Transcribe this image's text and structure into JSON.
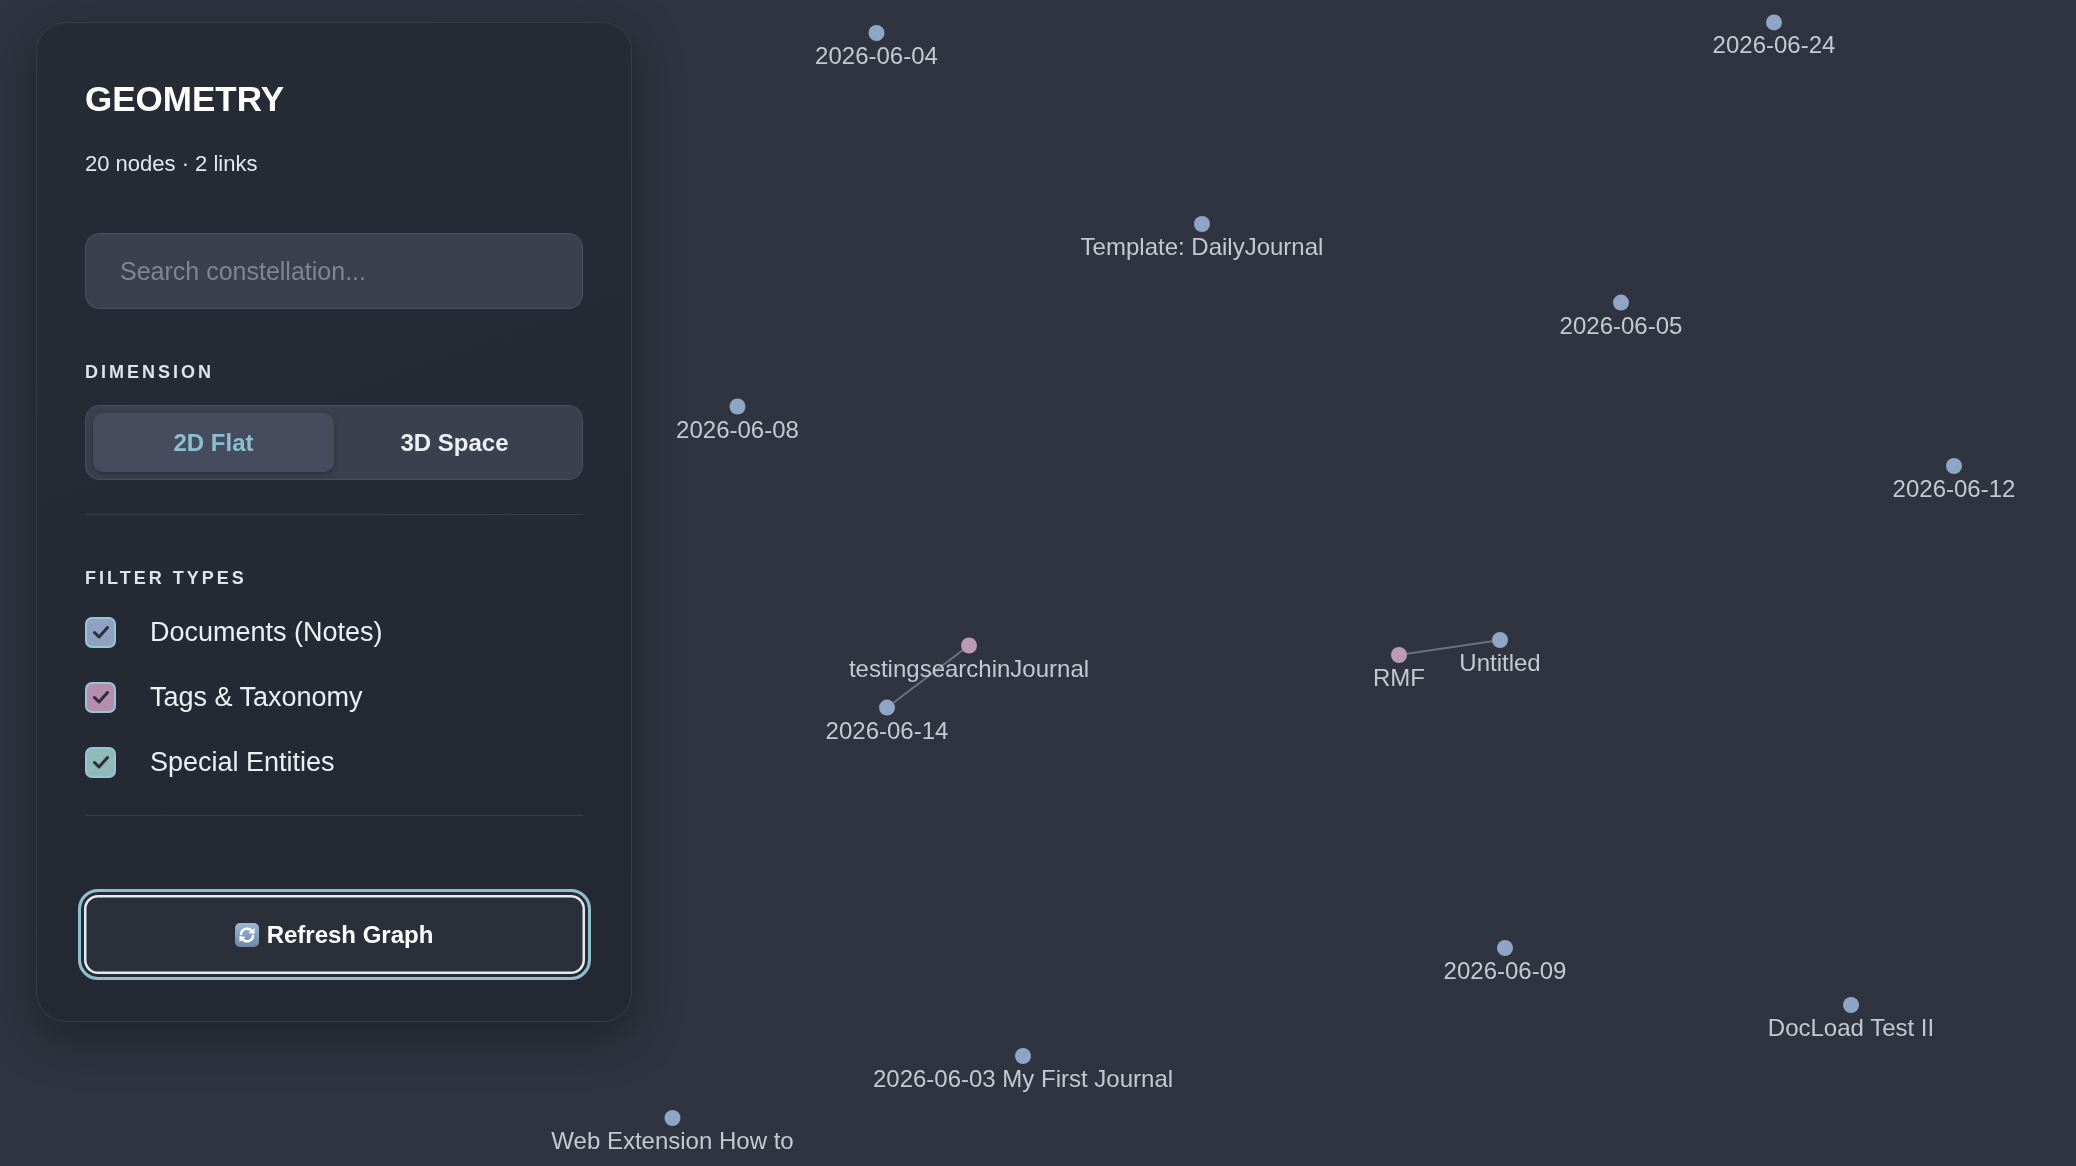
{
  "panel": {
    "title": "GEOMETRY",
    "stats": "20 nodes · 2 links",
    "search": {
      "placeholder": "Search constellation..."
    },
    "dimension": {
      "heading": "DIMENSION",
      "options": [
        {
          "label": "2D Flat",
          "selected": true
        },
        {
          "label": "3D Space",
          "selected": false
        }
      ]
    },
    "filters": {
      "heading": "FILTER TYPES",
      "items": [
        {
          "label": "Documents (Notes)",
          "checked": true,
          "color": "#8fa2c0"
        },
        {
          "label": "Tags & Taxonomy",
          "checked": true,
          "color": "#b48ead"
        },
        {
          "label": "Special Entities",
          "checked": true,
          "color": "#8fbab8"
        }
      ]
    },
    "refresh_button": {
      "label": "Refresh Graph",
      "focused": true
    }
  },
  "graph": {
    "nodes": [
      {
        "label": "2026-06-04",
        "color": "#8fa5c5"
      },
      {
        "label": "2026-06-24",
        "color": "#8fa5c5"
      },
      {
        "label": "Template: DailyJournal",
        "color": "#8fa5c5"
      },
      {
        "label": "2026-06-05",
        "color": "#8fa5c5"
      },
      {
        "label": "2026-06-08",
        "color": "#8fa5c5"
      },
      {
        "label": "2026-06-12",
        "color": "#8fa5c5"
      },
      {
        "label": "testingsearchinJournal",
        "color": "#bb9ab5",
        "links": [
          {
            "label": "2026-06-14",
            "color": "#8fa5c5"
          }
        ]
      },
      {
        "label": "RMF",
        "color": "#bb9ab5",
        "links": [
          {
            "label": "Untitled",
            "color": "#8fa5c5"
          }
        ]
      },
      {
        "label": "2026-06-09",
        "color": "#8fa5c5"
      },
      {
        "label": "DocLoad Test II",
        "color": "#8fa5c5"
      },
      {
        "label": "2026-06-03 My First Journal",
        "color": "#8fa5c5"
      },
      {
        "label": "Web Extension How to",
        "color": "#8fa5c5"
      }
    ]
  }
}
